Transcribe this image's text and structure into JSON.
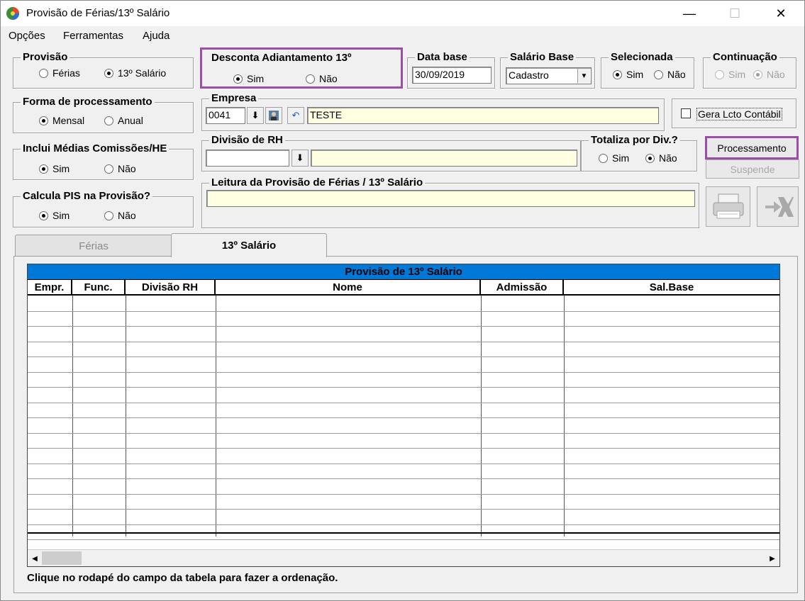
{
  "window": {
    "title": "Provisão de Férias/13º Salário",
    "min_glyph": "—",
    "max_glyph": "☐",
    "close_glyph": "✕"
  },
  "menu": [
    "Opções",
    "Ferramentas",
    "Ajuda"
  ],
  "provisao": {
    "title": "Provisão",
    "opt1": "Férias",
    "opt2": "13º Salário",
    "selected": "13º Salário"
  },
  "desconta": {
    "title": "Desconta Adiantamento 13º",
    "opt1": "Sim",
    "opt2": "Não",
    "selected": "Sim"
  },
  "data_base": {
    "title": "Data base",
    "value": "30/09/2019"
  },
  "salario_base": {
    "title": "Salário Base",
    "value": "Cadastro"
  },
  "selecionada": {
    "title": "Selecionada",
    "opt1": "Sim",
    "opt2": "Não",
    "selected": "Sim"
  },
  "continuacao": {
    "title": "Continuação",
    "opt1": "Sim",
    "opt2": "Não",
    "selected": "Não"
  },
  "forma": {
    "title": "Forma de processamento",
    "opt1": "Mensal",
    "opt2": "Anual",
    "selected": "Mensal"
  },
  "empresa": {
    "title": "Empresa",
    "code": "0041",
    "name": "TESTE"
  },
  "gera_lcto": {
    "label": "Gera Lcto Contábil",
    "checked": false
  },
  "inclui": {
    "title": "Inclui Médias Comissões/HE",
    "opt1": "Sim",
    "opt2": "Não",
    "selected": "Sim"
  },
  "divisao": {
    "title": "Divisão de RH",
    "code": "",
    "name": ""
  },
  "totaliza": {
    "title": "Totaliza por Div.?",
    "opt1": "Sim",
    "opt2": "Não",
    "selected": "Não"
  },
  "buttons": {
    "processamento": "Processamento",
    "suspende": "Suspende"
  },
  "calcula": {
    "title": "Calcula PIS na Provisão?",
    "opt1": "Sim",
    "opt2": "Não",
    "selected": "Sim"
  },
  "leitura": {
    "title": "Leitura da Provisão de Férias / 13º Salário",
    "value": ""
  },
  "tabs": [
    "Férias",
    "13º Salário"
  ],
  "grid": {
    "title": "Provisão de 13º Salário",
    "columns": [
      "Empr.",
      "Func.",
      "Divisão RH",
      "Nome",
      "Admissão",
      "Sal.Base"
    ]
  },
  "footer_note": "Clique no rodapé do campo da tabela  para fazer a ordenação.",
  "colors": {
    "accent": "#0078d7",
    "highlight": "#9b4ea5",
    "field_yellow": "#ffffe1"
  }
}
